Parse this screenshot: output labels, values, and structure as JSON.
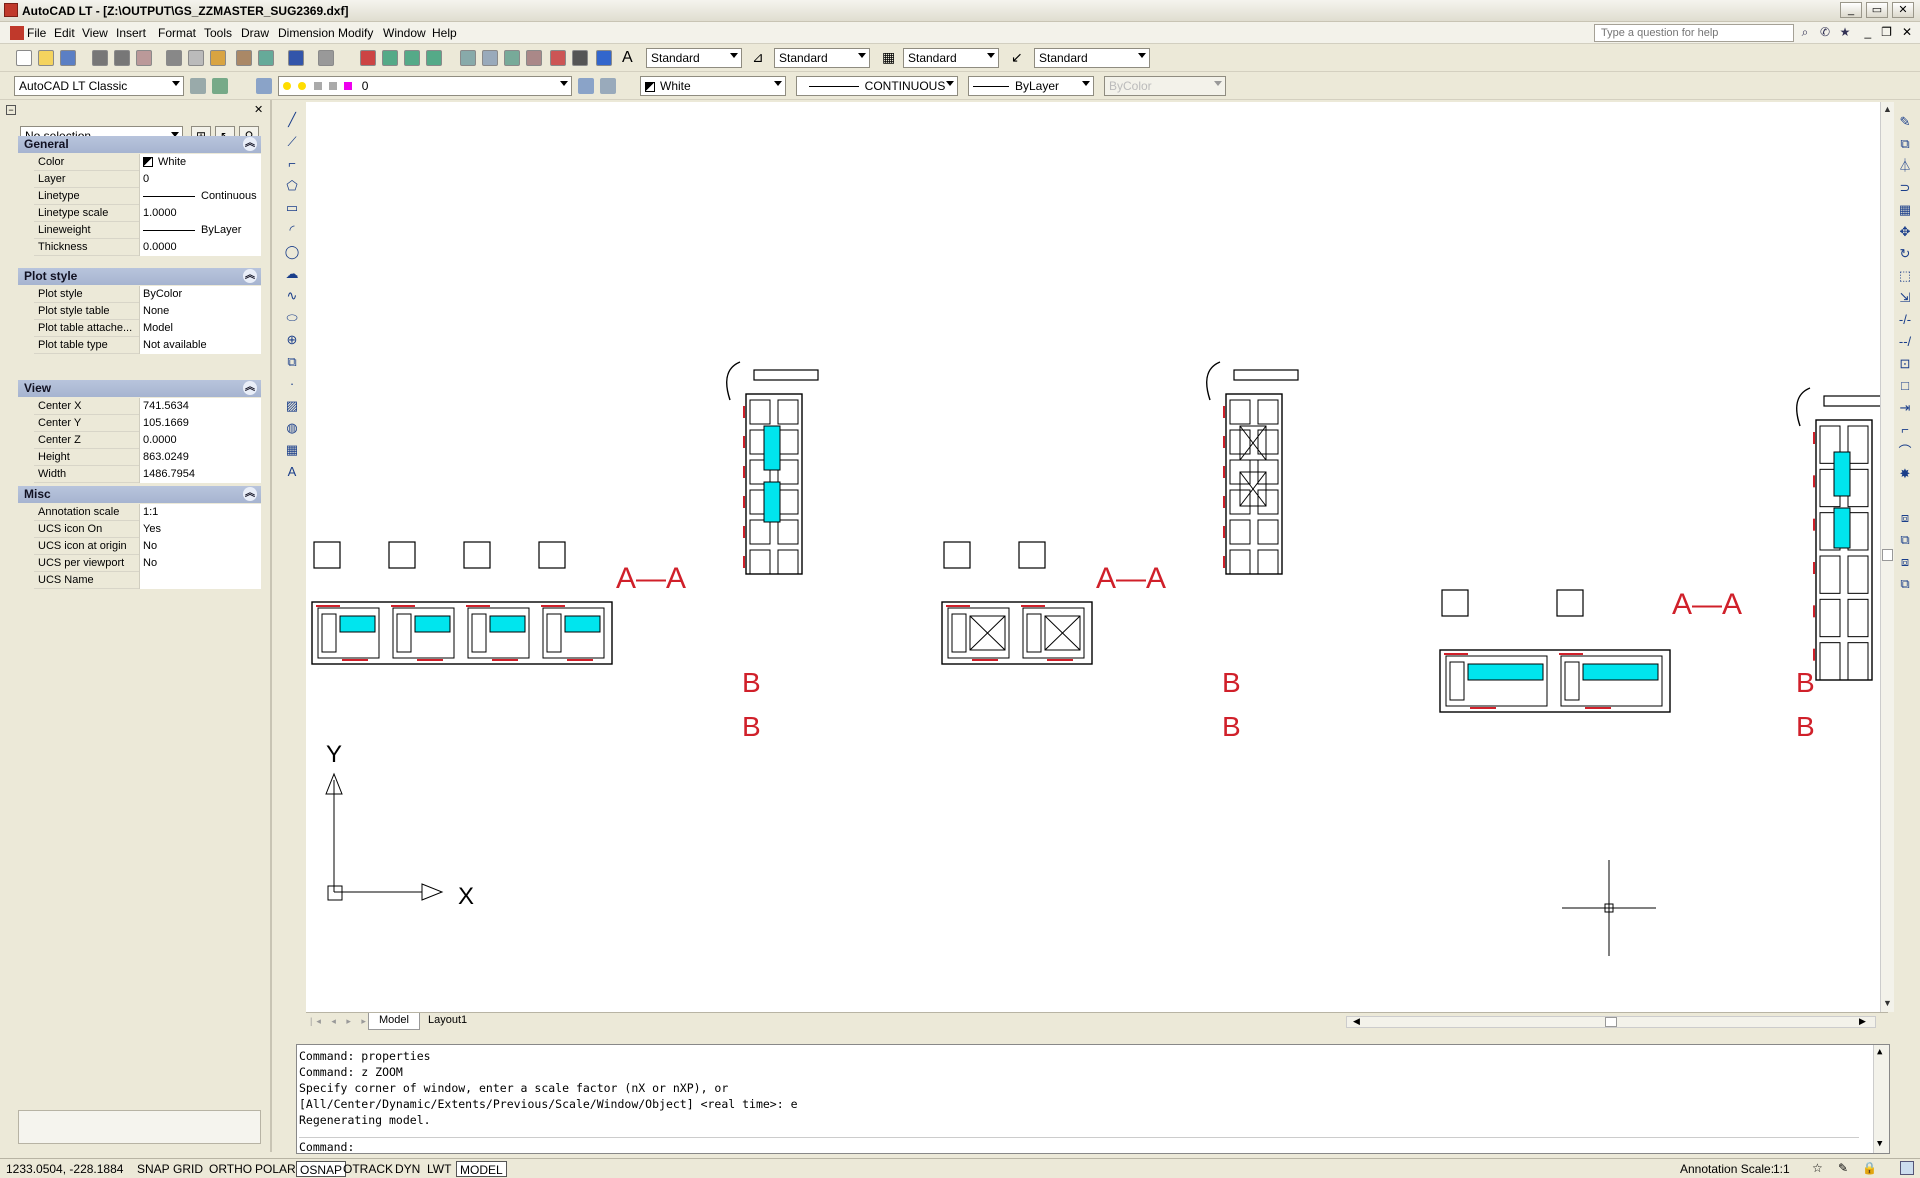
{
  "window": {
    "title": "AutoCAD LT - [Z:\\OUTPUT\\GS_ZZMASTER_SUG2369.dxf]"
  },
  "menu": [
    "File",
    "Edit",
    "View",
    "Insert",
    "Format",
    "Tools",
    "Draw",
    "Dimension",
    "Modify",
    "Window",
    "Help"
  ],
  "help": {
    "placeholder": "Type a question for help"
  },
  "styles_toolbar": {
    "text_style": "Standard",
    "dim_style": "Standard",
    "table_style": "Standard",
    "multileader_style": "Standard"
  },
  "workspace": "AutoCAD LT Classic",
  "layers_toolbar": {
    "current_layer": "0"
  },
  "properties_toolbar": {
    "color": "White",
    "linetype": "CONTINUOUS",
    "lineweight": "ByLayer",
    "plotstyle": "ByColor"
  },
  "palette": {
    "selection": "No selection",
    "sections": [
      {
        "title": "General",
        "rows": [
          {
            "key": "Color",
            "value": "White",
            "kind": "color"
          },
          {
            "key": "Layer",
            "value": "0"
          },
          {
            "key": "Linetype",
            "value": "Continuous",
            "kind": "line"
          },
          {
            "key": "Linetype scale",
            "value": "1.0000"
          },
          {
            "key": "Lineweight",
            "value": "ByLayer",
            "kind": "line"
          },
          {
            "key": "Thickness",
            "value": "0.0000"
          }
        ]
      },
      {
        "title": "Plot style",
        "rows": [
          {
            "key": "Plot style",
            "value": "ByColor"
          },
          {
            "key": "Plot style table",
            "value": "None"
          },
          {
            "key": "Plot table attache...",
            "value": "Model"
          },
          {
            "key": "Plot table type",
            "value": "Not available"
          }
        ]
      },
      {
        "title": "View",
        "rows": [
          {
            "key": "Center X",
            "value": "741.5634"
          },
          {
            "key": "Center Y",
            "value": "105.1669"
          },
          {
            "key": "Center Z",
            "value": "0.0000"
          },
          {
            "key": "Height",
            "value": "863.0249"
          },
          {
            "key": "Width",
            "value": "1486.7954"
          }
        ]
      },
      {
        "title": "Misc",
        "rows": [
          {
            "key": "Annotation scale",
            "value": "1:1"
          },
          {
            "key": "UCS icon On",
            "value": "Yes"
          },
          {
            "key": "UCS icon at origin",
            "value": "No"
          },
          {
            "key": "UCS per viewport",
            "value": "No"
          },
          {
            "key": "UCS Name",
            "value": ""
          }
        ]
      }
    ]
  },
  "drawing": {
    "section_a": "A—A",
    "section_b": "B",
    "ucs_x": "X",
    "ucs_y": "Y",
    "colors": {
      "profile": "#000000",
      "glass": "#00e5ee",
      "label": "#d0202a"
    }
  },
  "tabs": [
    "Model",
    "Layout1"
  ],
  "command_history": [
    "Command: properties",
    "Command: z ZOOM",
    "Specify corner of window, enter a scale factor (nX or nXP), or",
    "[All/Center/Dynamic/Extents/Previous/Scale/Window/Object] <real time>: e",
    "Regenerating model."
  ],
  "command_prompt": "Command:",
  "status": {
    "coords": "1233.0504, -228.1884",
    "buttons": [
      "SNAP",
      "GRID",
      "ORTHO",
      "POLAR",
      "OSNAP",
      "OTRACK",
      "DYN",
      "LWT",
      "MODEL"
    ],
    "active": [
      "OSNAP",
      "MODEL"
    ],
    "annotation_label": "Annotation Scale:",
    "annotation_scale": "1:1"
  }
}
